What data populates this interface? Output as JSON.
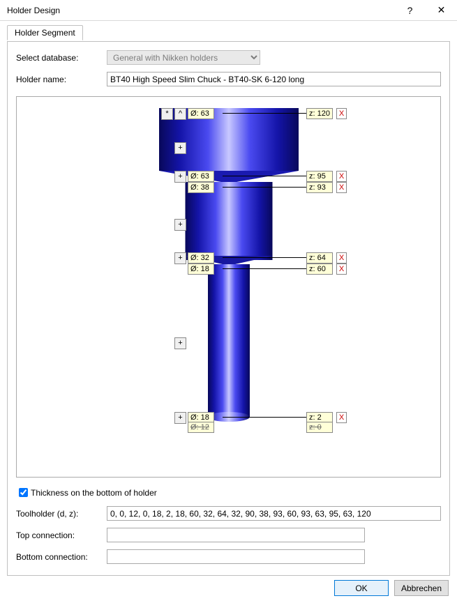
{
  "window": {
    "title": "Holder Design"
  },
  "tab": {
    "label": "Holder Segment"
  },
  "fields": {
    "select_db_label": "Select database:",
    "select_db_value": "General with Nikken holders",
    "holder_name_label": "Holder name:",
    "holder_name_value": "BT40 High Speed Slim Chuck - BT40-SK 6-120 long",
    "thickness_label": "Thickness on the bottom of holder",
    "toolholder_label": "Toolholder (d, z):",
    "toolholder_value": "0, 0, 12, 0, 18, 2, 18, 60, 32, 64, 32, 90, 38, 93, 60, 93, 63, 95, 63, 120",
    "top_conn_label": "Top connection:",
    "top_conn_value": "",
    "bottom_conn_label": "Bottom connection:",
    "bottom_conn_value": ""
  },
  "buttons": {
    "ok": "OK",
    "cancel": "Abbrechen",
    "help": "?",
    "close": "✕",
    "star": "*",
    "caret": "^",
    "plus": "+",
    "x": "X"
  },
  "dims": {
    "d63a": "Ø: 63",
    "d63b": "Ø: 63",
    "d38": "Ø: 38",
    "d32": "Ø: 32",
    "d18a": "Ø: 18",
    "d18b": "Ø: 18",
    "d12": "Ø: 12",
    "z120": "z: 120",
    "z95": "z: 95",
    "z93": "z: 93",
    "z64": "z: 64",
    "z60": "z: 60",
    "z2": "z: 2",
    "z0": "z: 0"
  },
  "chart_data": {
    "type": "table",
    "title": "Holder profile (d, z) pairs",
    "columns": [
      "d",
      "z"
    ],
    "rows": [
      [
        0,
        0
      ],
      [
        12,
        0
      ],
      [
        18,
        2
      ],
      [
        18,
        60
      ],
      [
        32,
        64
      ],
      [
        32,
        90
      ],
      [
        38,
        93
      ],
      [
        60,
        93
      ],
      [
        63,
        95
      ],
      [
        63,
        120
      ]
    ]
  }
}
